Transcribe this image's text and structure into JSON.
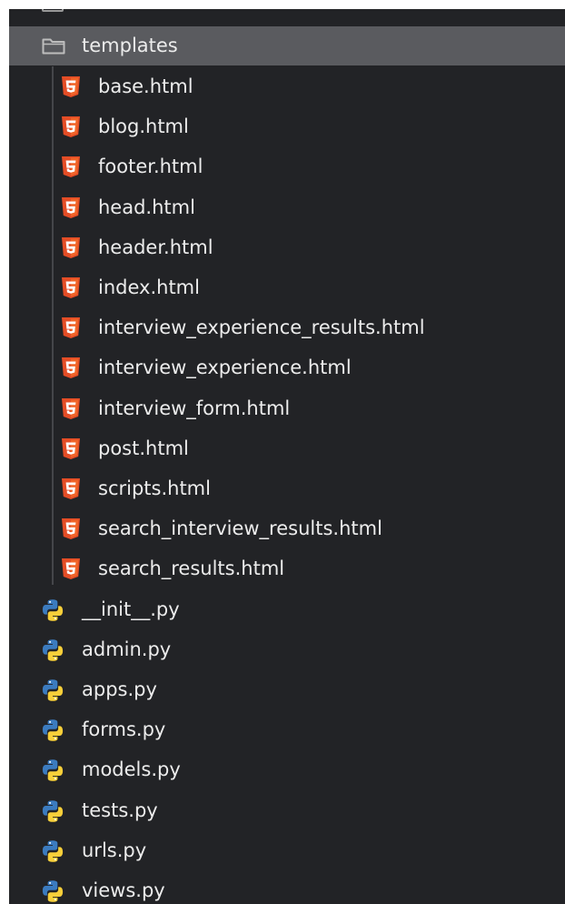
{
  "tree": {
    "folder": {
      "name": "templates",
      "icon": "folder-open-icon",
      "selected": true,
      "children": [
        {
          "name": "base.html",
          "icon": "html5-icon"
        },
        {
          "name": "blog.html",
          "icon": "html5-icon"
        },
        {
          "name": "footer.html",
          "icon": "html5-icon"
        },
        {
          "name": "head.html",
          "icon": "html5-icon"
        },
        {
          "name": "header.html",
          "icon": "html5-icon"
        },
        {
          "name": "index.html",
          "icon": "html5-icon"
        },
        {
          "name": "interview_experience_results.html",
          "icon": "html5-icon"
        },
        {
          "name": "interview_experience.html",
          "icon": "html5-icon"
        },
        {
          "name": "interview_form.html",
          "icon": "html5-icon"
        },
        {
          "name": "post.html",
          "icon": "html5-icon"
        },
        {
          "name": "scripts.html",
          "icon": "html5-icon"
        },
        {
          "name": "search_interview_results.html",
          "icon": "html5-icon"
        },
        {
          "name": "search_results.html",
          "icon": "html5-icon"
        }
      ]
    },
    "files": [
      {
        "name": "__init__.py",
        "icon": "python-icon"
      },
      {
        "name": "admin.py",
        "icon": "python-icon"
      },
      {
        "name": "apps.py",
        "icon": "python-icon"
      },
      {
        "name": "forms.py",
        "icon": "python-icon"
      },
      {
        "name": "models.py",
        "icon": "python-icon"
      },
      {
        "name": "tests.py",
        "icon": "python-icon"
      },
      {
        "name": "urls.py",
        "icon": "python-icon"
      },
      {
        "name": "views.py",
        "icon": "python-icon"
      }
    ]
  },
  "colors": {
    "background": "#222326",
    "selected_row": "#5a5b5f",
    "text": "#ececec",
    "html5_orange": "#e44d26",
    "python_blue": "#3b7bbf",
    "python_yellow": "#f7cf3a"
  }
}
